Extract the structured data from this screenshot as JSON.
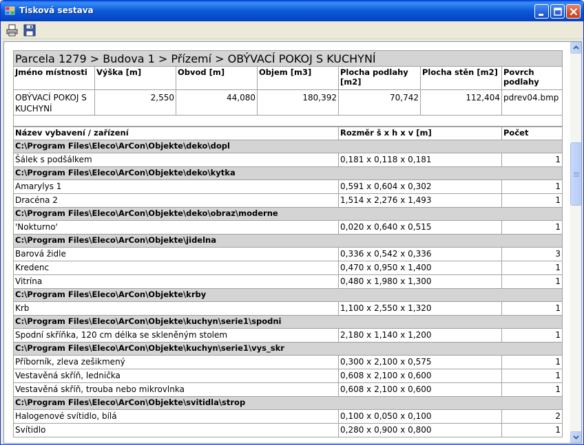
{
  "window": {
    "title": "Tisková sestava"
  },
  "toolbar": {
    "print_icon": "printer-icon",
    "save_icon": "floppy-disk-icon"
  },
  "room_path": "Parcela 1279 > Budova 1 > Přízemí > OBÝVACÍ POKOJ S KUCHYNÍ",
  "room_headers": [
    "Jméno místnosti",
    "Výška [m]",
    "Obvod [m]",
    "Objem [m3]",
    "Plocha podlahy [m2]",
    "Plocha stěn [m2]",
    "Povrch podlahy"
  ],
  "room_values": [
    "OBÝVACÍ POKOJ S KUCHYNÍ",
    "2,550",
    "44,080",
    "180,392",
    "70,742",
    "112,404",
    "pdrev04.bmp"
  ],
  "equipment_headers": {
    "name": "Název vybavení / zařízení",
    "size": "Rozměr š x h x v [m]",
    "count": "Počet"
  },
  "groups": [
    {
      "path": "C:\\Program Files\\Eleco\\ArCon\\Objekte\\deko\\dopl",
      "items": [
        {
          "name": "Šálek s podšálkem",
          "size": "0,181 x 0,118 x 0,181",
          "count": "1"
        }
      ]
    },
    {
      "path": "C:\\Program Files\\Eleco\\ArCon\\Objekte\\deko\\kytka",
      "items": [
        {
          "name": "Amarylys 1",
          "size": "0,591 x 0,604 x 0,302",
          "count": "1"
        },
        {
          "name": "Dracéna 2",
          "size": "1,514 x 2,276 x 1,493",
          "count": "1"
        }
      ]
    },
    {
      "path": "C:\\Program Files\\Eleco\\ArCon\\Objekte\\deko\\obraz\\moderne",
      "items": [
        {
          "name": "'Nokturno'",
          "size": "0,020 x 0,640 x 0,515",
          "count": "1"
        }
      ]
    },
    {
      "path": "C:\\Program Files\\Eleco\\ArCon\\Objekte\\jidelna",
      "items": [
        {
          "name": "Barová židle",
          "size": "0,336 x 0,542 x 0,336",
          "count": "3"
        },
        {
          "name": "Kredenc",
          "size": "0,470 x 0,950 x 1,400",
          "count": "1"
        },
        {
          "name": "Vitrína",
          "size": "0,480 x 1,980 x 1,300",
          "count": "1"
        }
      ]
    },
    {
      "path": "C:\\Program Files\\Eleco\\ArCon\\Objekte\\krby",
      "items": [
        {
          "name": "Krb",
          "size": "1,100 x 2,550 x 1,320",
          "count": "1"
        }
      ]
    },
    {
      "path": "C:\\Program Files\\Eleco\\ArCon\\Objekte\\kuchyn\\serie1\\spodni",
      "items": [
        {
          "name": "Spodní skříňka, 120 cm délka se skleněným stolem",
          "size": "2,180 x 1,140 x 1,200",
          "count": "1"
        }
      ]
    },
    {
      "path": "C:\\Program Files\\Eleco\\ArCon\\Objekte\\kuchyn\\serie1\\vys_skr",
      "items": [
        {
          "name": "Příborník, zleva zešikmený",
          "size": "0,300 x 2,100 x 0,575",
          "count": "1"
        },
        {
          "name": "Vestavěná skříň, lednička",
          "size": "0,608 x 2,100 x 0,600",
          "count": "1"
        },
        {
          "name": "Vestavěná skříň, trouba nebo mikrovlnka",
          "size": "0,608 x 2,100 x 0,600",
          "count": "1"
        }
      ]
    },
    {
      "path": "C:\\Program Files\\Eleco\\ArCon\\Objekte\\svitidla\\strop",
      "items": [
        {
          "name": "Halogenové svítidlo, bílá",
          "size": "0,100 x 0,050 x 0,100",
          "count": "2"
        },
        {
          "name": "Svítidlo",
          "size": "0,280 x 0,900 x 0,800",
          "count": "1"
        }
      ]
    }
  ],
  "scrollbar": {
    "position": 0.27
  }
}
